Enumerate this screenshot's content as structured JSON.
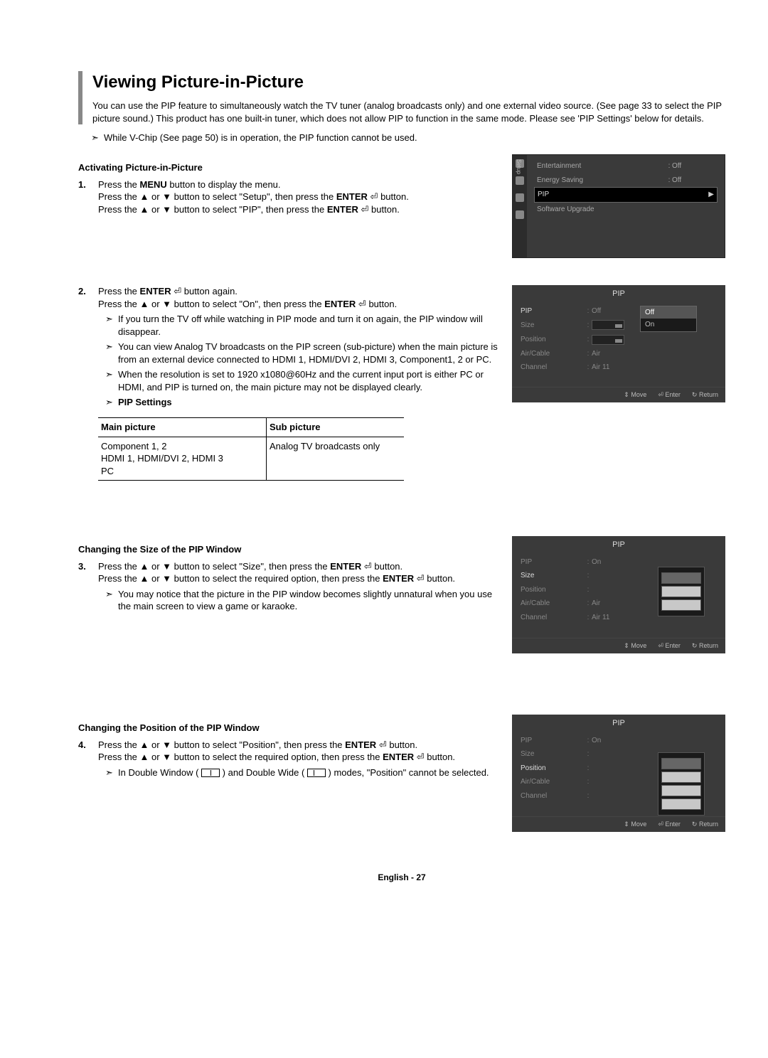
{
  "title": "Viewing Picture-in-Picture",
  "intro": "You can use the PIP feature to simultaneously watch the TV tuner (analog broadcasts only) and one external video source. (See page 33 to select the PIP picture sound.)  This product has one built-in tuner, which does not allow PIP to function in the same mode. Please see 'PIP Settings' below for details.",
  "top_note": "While V-Chip (See page 50) is in operation, the PIP function cannot be used.",
  "sec1": {
    "head": "Activating Picture-in-Picture",
    "step1_num": "1.",
    "step1_l1a": "Press the ",
    "step1_l1b": "MENU",
    "step1_l1c": " button to display the menu.",
    "step1_l2a": "Press the ▲ or ▼ button to select \"Setup\", then press the ",
    "step1_l2b": "ENTER",
    "step1_l2c": " button.",
    "step1_l3a": "Press the ▲ or ▼ button to select \"PIP\", then press the ",
    "step1_l3b": "ENTER",
    "step1_l3c": " button.",
    "step2_num": "2.",
    "step2_l1a": "Press the ",
    "step2_l1b": "ENTER",
    "step2_l1c": " button again.",
    "step2_l2a": "Press the ▲ or ▼ button to select \"On\", then press the ",
    "step2_l2b": "ENTER",
    "step2_l2c": " button.",
    "step2_n1": "If you turn the TV off while watching in PIP mode and turn it on again, the PIP window will disappear.",
    "step2_n2": "You can view Analog TV broadcasts on the PIP screen (sub-picture) when the main picture is from an external device connected to HDMI 1, HDMI/DVI 2, HDMI 3, Component1, 2 or PC.",
    "step2_n3": "When the resolution is set to 1920 x1080@60Hz and the current input port is either PC or HDMI, and PIP is turned on, the main picture may not be displayed clearly.",
    "pip_settings": "PIP Settings",
    "tbl_h1": "Main picture",
    "tbl_h2": "Sub picture",
    "tbl_c1a": "Component 1, 2",
    "tbl_c1b": "HDMI 1, HDMI/DVI 2, HDMI 3",
    "tbl_c1c": "PC",
    "tbl_c2": "Analog TV broadcasts only"
  },
  "osd_setup": {
    "sidebar_label": "Setup",
    "r1_lab": "Entertainment",
    "r1_val": "Off",
    "r2_lab": "Energy Saving",
    "r2_val": "Off",
    "r3_lab": "PIP",
    "r4_lab": "Software Upgrade"
  },
  "osd_pip1": {
    "title": "PIP",
    "r1_lab": "PIP",
    "r1_val": "Off",
    "r2_lab": "Size",
    "opt_on": "On",
    "r3_lab": "Position",
    "r4_lab": "Air/Cable",
    "r4_val": "Air",
    "r5_lab": "Channel",
    "r5_val": "Air 11",
    "move": "Move",
    "enter": "Enter",
    "return": "Return"
  },
  "sec3": {
    "head": "Changing the Size of the PIP Window",
    "num": "3.",
    "l1a": "Press the ▲ or ▼ button to select \"Size\", then press the ",
    "l1b": "ENTER",
    "l1c": " button.",
    "l2a": "Press the ▲ or ▼ button to select the required option, then press the ",
    "l2b": "ENTER",
    "l2c": " button.",
    "n1": "You may notice that the picture in the PIP window becomes slightly unnatural when you use the main screen to view a game or karaoke."
  },
  "osd_pip2": {
    "title": "PIP",
    "r1_lab": "PIP",
    "r1_val": "On",
    "r2_lab": "Size",
    "r3_lab": "Position",
    "r4_lab": "Air/Cable",
    "r4_val": "Air",
    "r5_lab": "Channel",
    "r5_val": "Air 11",
    "move": "Move",
    "enter": "Enter",
    "return": "Return"
  },
  "sec4": {
    "head": "Changing the Position of the PIP Window",
    "num": "4.",
    "l1a": "Press the ▲ or ▼ button to select \"Position\", then press the ",
    "l1b": "ENTER",
    "l1c": " button.",
    "l2a": "Press the ▲ or ▼ button to select the required option, then press the ",
    "l2b": "ENTER",
    "l2c": " button.",
    "n1a": "In Double Window ( ",
    "n1b": " ) and Double Wide ( ",
    "n1c": " ) modes, \"Position\" cannot be selected."
  },
  "osd_pip3": {
    "title": "PIP",
    "r1_lab": "PIP",
    "r1_val": "On",
    "r2_lab": "Size",
    "r3_lab": "Position",
    "r4_lab": "Air/Cable",
    "r5_lab": "Channel",
    "move": "Move",
    "enter": "Enter",
    "return": "Return"
  },
  "footer": "English - 27",
  "glyph": {
    "note": "➣",
    "enter": "⏎",
    "updown": "⇕",
    "ret": "↻"
  }
}
